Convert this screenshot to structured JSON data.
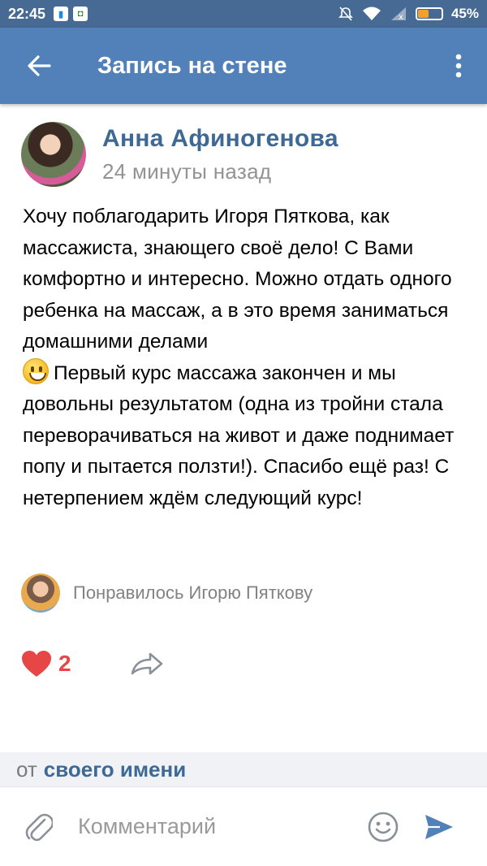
{
  "status_bar": {
    "time": "22:45",
    "battery_percent": "45%",
    "battery_level": 0.45,
    "icons": [
      "notification-app-icon",
      "shield-app-icon",
      "silent-icon",
      "wifi-icon",
      "no-signal-icon",
      "battery-icon"
    ]
  },
  "header": {
    "title": "Запись на стене",
    "back_icon": "arrow-left-icon",
    "menu_icon": "more-vertical-icon",
    "background": "#5181b8"
  },
  "post": {
    "author": "Анна Афиногенова",
    "time": "24 минуты назад",
    "text_before_emoji": "Хочу поблагодарить Игоря Пяткова, как массажиста, знающего своё дело! С Вами комфортно и интересно. Можно отдать одного ребенка на массаж, а в это время заниматься домашними делами",
    "emoji": "smile-emoji",
    "text_after_emoji": "Первый курс массажа закончен и мы довольны результатом (одна из тройни стала переворачиваться на живот и даже поднимает попу и пытается ползти!). Спасибо ещё раз! С нетерпением ждём следующий курс!",
    "liked_by": "Понравилось Игорю Пяткову",
    "likes_count": "2",
    "like_color": "#e64646",
    "link_color": "#3f6995"
  },
  "reply": {
    "prefix": "от",
    "as_name": "своего имени"
  },
  "comment": {
    "placeholder": "Комментарий",
    "send_color": "#5181b8"
  }
}
